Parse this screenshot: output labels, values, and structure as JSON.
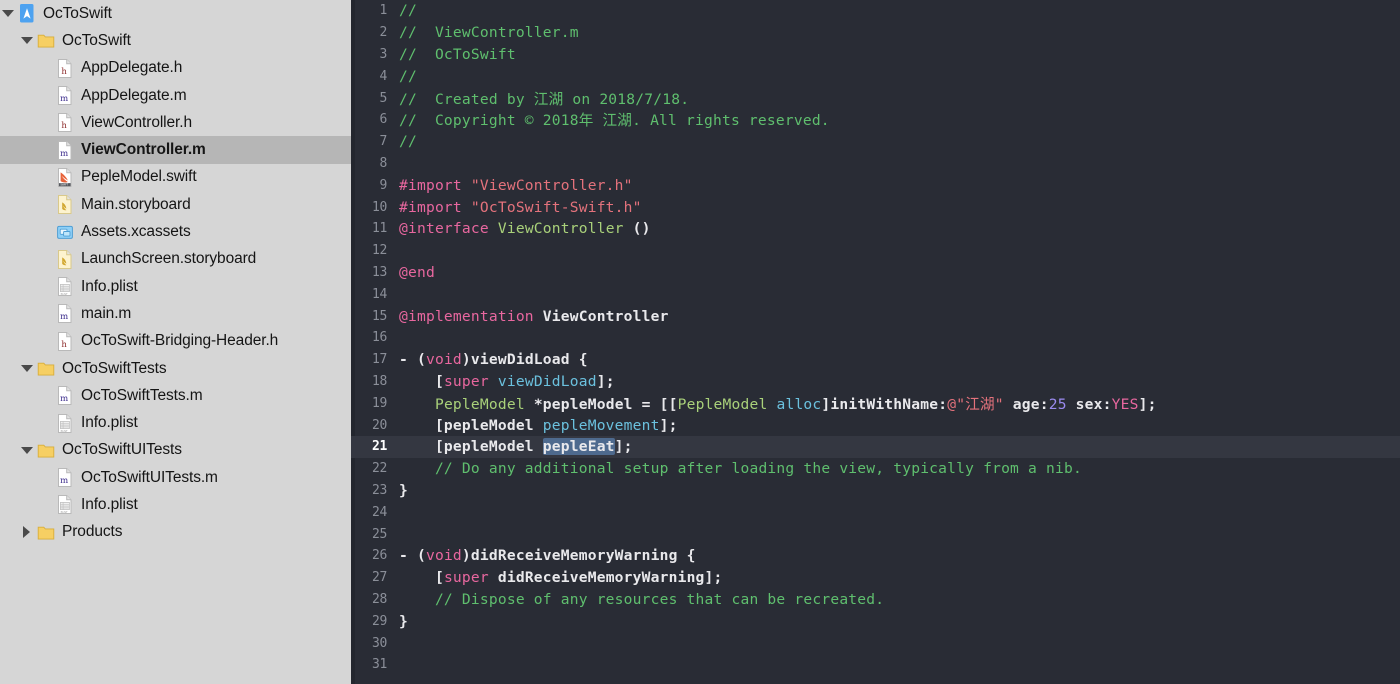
{
  "window": {
    "title": "OcToSwift"
  },
  "navigator": {
    "items": [
      {
        "label": "OcToSwift",
        "icon": "xcode-project-icon",
        "indent": 0,
        "disclosure": "open",
        "selected": false
      },
      {
        "label": "OcToSwift",
        "icon": "folder-icon",
        "indent": 1,
        "disclosure": "open",
        "selected": false
      },
      {
        "label": "AppDelegate.h",
        "icon": "header-file-icon",
        "indent": 2,
        "disclosure": "none",
        "selected": false
      },
      {
        "label": "AppDelegate.m",
        "icon": "objc-file-icon",
        "indent": 2,
        "disclosure": "none",
        "selected": false
      },
      {
        "label": "ViewController.h",
        "icon": "header-file-icon",
        "indent": 2,
        "disclosure": "none",
        "selected": false
      },
      {
        "label": "ViewController.m",
        "icon": "objc-file-icon",
        "indent": 2,
        "disclosure": "none",
        "selected": true
      },
      {
        "label": "PepleModel.swift",
        "icon": "swift-file-icon",
        "indent": 2,
        "disclosure": "none",
        "selected": false
      },
      {
        "label": "Main.storyboard",
        "icon": "storyboard-file-icon",
        "indent": 2,
        "disclosure": "none",
        "selected": false
      },
      {
        "label": "Assets.xcassets",
        "icon": "assets-catalog-icon",
        "indent": 2,
        "disclosure": "none",
        "selected": false
      },
      {
        "label": "LaunchScreen.storyboard",
        "icon": "storyboard-file-icon",
        "indent": 2,
        "disclosure": "none",
        "selected": false
      },
      {
        "label": "Info.plist",
        "icon": "plist-file-icon",
        "indent": 2,
        "disclosure": "none",
        "selected": false
      },
      {
        "label": "main.m",
        "icon": "objc-file-icon",
        "indent": 2,
        "disclosure": "none",
        "selected": false
      },
      {
        "label": "OcToSwift-Bridging-Header.h",
        "icon": "header-file-icon",
        "indent": 2,
        "disclosure": "none",
        "selected": false
      },
      {
        "label": "OcToSwiftTests",
        "icon": "folder-icon",
        "indent": 1,
        "disclosure": "open",
        "selected": false
      },
      {
        "label": "OcToSwiftTests.m",
        "icon": "objc-file-icon",
        "indent": 2,
        "disclosure": "none",
        "selected": false
      },
      {
        "label": "Info.plist",
        "icon": "plist-file-icon",
        "indent": 2,
        "disclosure": "none",
        "selected": false
      },
      {
        "label": "OcToSwiftUITests",
        "icon": "folder-icon",
        "indent": 1,
        "disclosure": "open",
        "selected": false
      },
      {
        "label": "OcToSwiftUITests.m",
        "icon": "objc-file-icon",
        "indent": 2,
        "disclosure": "none",
        "selected": false
      },
      {
        "label": "Info.plist",
        "icon": "plist-file-icon",
        "indent": 2,
        "disclosure": "none",
        "selected": false
      },
      {
        "label": "Products",
        "icon": "folder-icon",
        "indent": 1,
        "disclosure": "closed",
        "selected": false
      }
    ]
  },
  "editor": {
    "file": "ViewController.m",
    "current_line": 21,
    "selection_text": "pepleEat",
    "colors": {
      "background": "#292c35",
      "current_line": "#343741",
      "comment": "#5fbf6e",
      "preprocessor": "#e8679f",
      "string": "#e4727c",
      "keyword": "#e8679f",
      "type": "#a9d17a",
      "method": "#6bc1de",
      "number": "#9b8bf0",
      "selection": "#4e6a8e",
      "plain": "#e9e9ec"
    },
    "lines": [
      {
        "n": 1,
        "tokens": [
          {
            "t": "//",
            "c": "com"
          }
        ]
      },
      {
        "n": 2,
        "tokens": [
          {
            "t": "//  ViewController.m",
            "c": "com"
          }
        ]
      },
      {
        "n": 3,
        "tokens": [
          {
            "t": "//  OcToSwift",
            "c": "com"
          }
        ]
      },
      {
        "n": 4,
        "tokens": [
          {
            "t": "//",
            "c": "com"
          }
        ]
      },
      {
        "n": 5,
        "tokens": [
          {
            "t": "//  Created by 江湖 on 2018/7/18.",
            "c": "com"
          }
        ]
      },
      {
        "n": 6,
        "tokens": [
          {
            "t": "//  Copyright © 2018年 江湖. All rights reserved.",
            "c": "com"
          }
        ]
      },
      {
        "n": 7,
        "tokens": [
          {
            "t": "//",
            "c": "com"
          }
        ]
      },
      {
        "n": 8,
        "tokens": []
      },
      {
        "n": 9,
        "tokens": [
          {
            "t": "#import ",
            "c": "pre"
          },
          {
            "t": "\"ViewController.h\"",
            "c": "str"
          }
        ]
      },
      {
        "n": 10,
        "tokens": [
          {
            "t": "#import ",
            "c": "pre"
          },
          {
            "t": "\"OcToSwift-Swift.h\"",
            "c": "str"
          }
        ]
      },
      {
        "n": 11,
        "tokens": [
          {
            "t": "@interface ",
            "c": "kw"
          },
          {
            "t": "ViewController",
            "c": "type"
          },
          {
            "t": " ()",
            "c": "plain"
          }
        ]
      },
      {
        "n": 12,
        "tokens": []
      },
      {
        "n": 13,
        "tokens": [
          {
            "t": "@end",
            "c": "kw"
          }
        ]
      },
      {
        "n": 14,
        "tokens": []
      },
      {
        "n": 15,
        "tokens": [
          {
            "t": "@implementation ",
            "c": "kw"
          },
          {
            "t": "ViewController",
            "c": "plain"
          }
        ]
      },
      {
        "n": 16,
        "tokens": []
      },
      {
        "n": 17,
        "tokens": [
          {
            "t": "- (",
            "c": "plain"
          },
          {
            "t": "void",
            "c": "kw"
          },
          {
            "t": ")viewDidLoad {",
            "c": "plain"
          }
        ]
      },
      {
        "n": 18,
        "tokens": [
          {
            "t": "    [",
            "c": "plain"
          },
          {
            "t": "super",
            "c": "kw"
          },
          {
            "t": " ",
            "c": "plain"
          },
          {
            "t": "viewDidLoad",
            "c": "meth"
          },
          {
            "t": "];",
            "c": "plain"
          }
        ]
      },
      {
        "n": 19,
        "tokens": [
          {
            "t": "    ",
            "c": "plain"
          },
          {
            "t": "PepleModel",
            "c": "type"
          },
          {
            "t": " *pepleModel = [[",
            "c": "plain"
          },
          {
            "t": "PepleModel",
            "c": "type"
          },
          {
            "t": " ",
            "c": "plain"
          },
          {
            "t": "alloc",
            "c": "meth"
          },
          {
            "t": "]initWithName:",
            "c": "plain"
          },
          {
            "t": "@\"江湖\"",
            "c": "str"
          },
          {
            "t": " age:",
            "c": "plain"
          },
          {
            "t": "25",
            "c": "num"
          },
          {
            "t": " sex:",
            "c": "plain"
          },
          {
            "t": "YES",
            "c": "kw"
          },
          {
            "t": "];",
            "c": "plain"
          }
        ]
      },
      {
        "n": 20,
        "tokens": [
          {
            "t": "    [pepleModel ",
            "c": "plain"
          },
          {
            "t": "pepleMovement",
            "c": "meth"
          },
          {
            "t": "];",
            "c": "plain"
          }
        ]
      },
      {
        "n": 21,
        "tokens": [
          {
            "t": "    [pepleModel ",
            "c": "plain"
          },
          {
            "t": "pepleEat",
            "c": "sel"
          },
          {
            "t": "];",
            "c": "plain"
          }
        ],
        "current": true
      },
      {
        "n": 22,
        "tokens": [
          {
            "t": "    // Do any additional setup after loading the view, typically from a nib.",
            "c": "com"
          }
        ]
      },
      {
        "n": 23,
        "tokens": [
          {
            "t": "}",
            "c": "plain"
          }
        ]
      },
      {
        "n": 24,
        "tokens": []
      },
      {
        "n": 25,
        "tokens": []
      },
      {
        "n": 26,
        "tokens": [
          {
            "t": "- (",
            "c": "plain"
          },
          {
            "t": "void",
            "c": "kw"
          },
          {
            "t": ")didReceiveMemoryWarning {",
            "c": "plain"
          }
        ]
      },
      {
        "n": 27,
        "tokens": [
          {
            "t": "    [",
            "c": "plain"
          },
          {
            "t": "super",
            "c": "kw"
          },
          {
            "t": " didReceiveMemoryWarning];",
            "c": "plain"
          }
        ]
      },
      {
        "n": 28,
        "tokens": [
          {
            "t": "    // Dispose of any resources that can be recreated.",
            "c": "com"
          }
        ]
      },
      {
        "n": 29,
        "tokens": [
          {
            "t": "}",
            "c": "plain"
          }
        ]
      },
      {
        "n": 30,
        "tokens": []
      },
      {
        "n": 31,
        "tokens": []
      }
    ]
  }
}
